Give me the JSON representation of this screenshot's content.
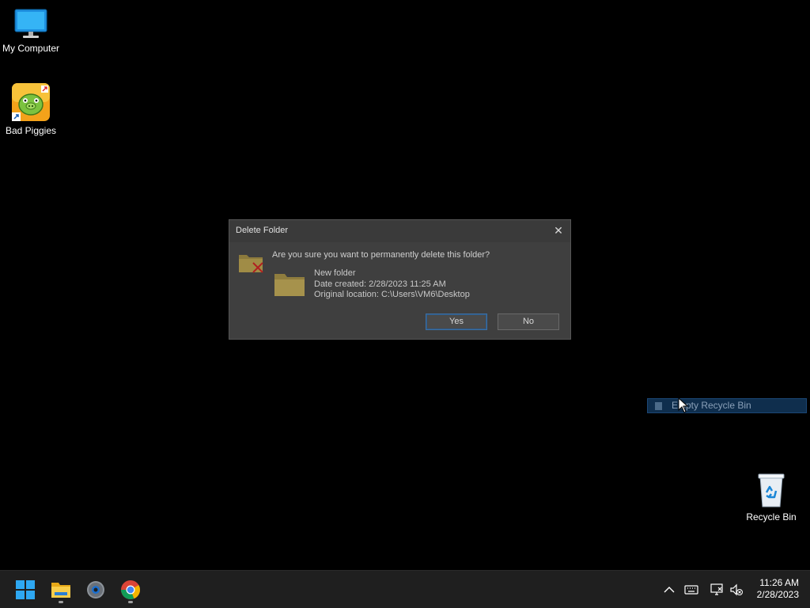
{
  "desktop": {
    "icons": [
      {
        "label": "My Computer",
        "icon": "monitor-icon"
      },
      {
        "label": "Bad Piggies",
        "icon": "bad-piggies-icon"
      },
      {
        "label": "Recycle Bin",
        "icon": "recycle-bin-icon"
      }
    ]
  },
  "dialog": {
    "title": "Delete Folder",
    "close_label": "✕",
    "question": "Are you sure you want to permanently delete this folder?",
    "item_name": "New folder",
    "date_created": "Date created: 2/28/2023 11:25 AM",
    "original_location": "Original location: C:\\Users\\VM6\\Desktop",
    "yes_label": "Yes",
    "no_label": "No"
  },
  "context_menu": {
    "item_label": "Empty Recycle Bin",
    "accent": "#1b4675"
  },
  "taskbar": {
    "apps": [
      {
        "name": "start",
        "icon": "windows-logo-icon"
      },
      {
        "name": "file-explorer",
        "icon": "folder-icon"
      },
      {
        "name": "settings",
        "icon": "gear-icon"
      },
      {
        "name": "chrome",
        "icon": "chrome-icon"
      }
    ],
    "tray": [
      "chevron-up-icon",
      "keyboard-icon",
      "network-icon",
      "volume-muted-icon"
    ],
    "time": "11:26 AM",
    "date": "2/28/2023"
  }
}
